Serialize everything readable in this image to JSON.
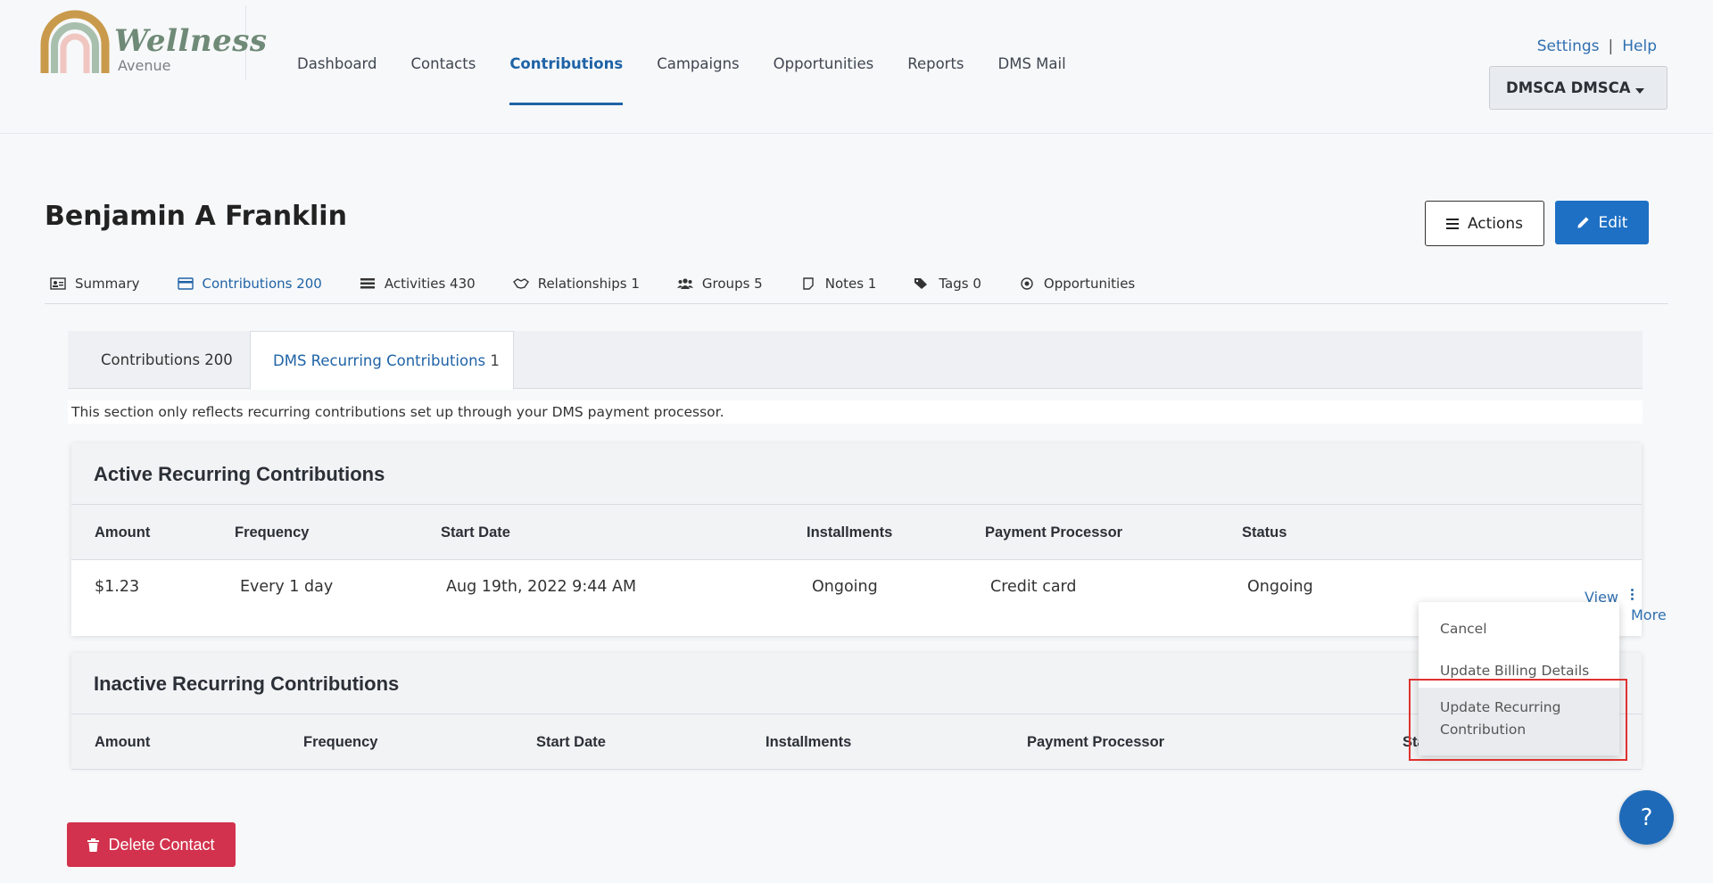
{
  "brand": {
    "name": "Wellness",
    "sub": "Avenue"
  },
  "nav": [
    {
      "label": "Dashboard"
    },
    {
      "label": "Contacts"
    },
    {
      "label": "Contributions",
      "active": true
    },
    {
      "label": "Campaigns"
    },
    {
      "label": "Opportunities"
    },
    {
      "label": "Reports"
    },
    {
      "label": "DMS Mail"
    }
  ],
  "top_links": {
    "settings": "Settings",
    "separator": "|",
    "help": "Help"
  },
  "user_menu": {
    "label": "DMSCA DMSCA"
  },
  "contact": {
    "name": "Benjamin A Franklin"
  },
  "buttons": {
    "actions": "Actions",
    "edit": "Edit",
    "delete": "Delete Contact",
    "help_fab": "?"
  },
  "contact_tabs": [
    {
      "label": "Summary",
      "icon": "id-card-icon"
    },
    {
      "label": "Contributions 200",
      "icon": "credit-card-icon",
      "active": true
    },
    {
      "label": "Activities 430",
      "icon": "list-icon"
    },
    {
      "label": "Relationships 1",
      "icon": "handshake-icon"
    },
    {
      "label": "Groups 5",
      "icon": "users-icon"
    },
    {
      "label": "Notes 1",
      "icon": "note-icon"
    },
    {
      "label": "Tags 0",
      "icon": "tags-icon"
    },
    {
      "label": "Opportunities",
      "icon": "target-icon"
    }
  ],
  "subtabs": {
    "contributions": "Contributions 200",
    "recurring_label": "DMS Recurring Contributions",
    "recurring_count": "1"
  },
  "notice": "This section only reflects recurring contributions set up through your DMS payment processor.",
  "active_section": {
    "title": "Active Recurring Contributions",
    "columns": [
      "Amount",
      "Frequency",
      "Start Date",
      "Installments",
      "Payment Processor",
      "Status"
    ],
    "rows": [
      [
        "$1.23",
        "Every 1 day",
        "Aug 19th, 2022 9:44 AM",
        "Ongoing",
        "Credit card",
        "Ongoing"
      ]
    ],
    "row_links": {
      "view": "View",
      "more": "More"
    }
  },
  "inactive_section": {
    "title": "Inactive Recurring Contributions",
    "columns": [
      "Amount",
      "Frequency",
      "Start Date",
      "Installments",
      "Payment Processor",
      "Sta"
    ]
  },
  "more_menu": {
    "items": [
      "Cancel",
      "Update Billing Details",
      "Update Recurring Contribution"
    ],
    "highlighted_index": 2
  },
  "colors": {
    "accent": "#1f63a6",
    "edit_button": "#1e70c4",
    "delete_button": "#d2324d",
    "highlight_box": "#e0322f"
  }
}
